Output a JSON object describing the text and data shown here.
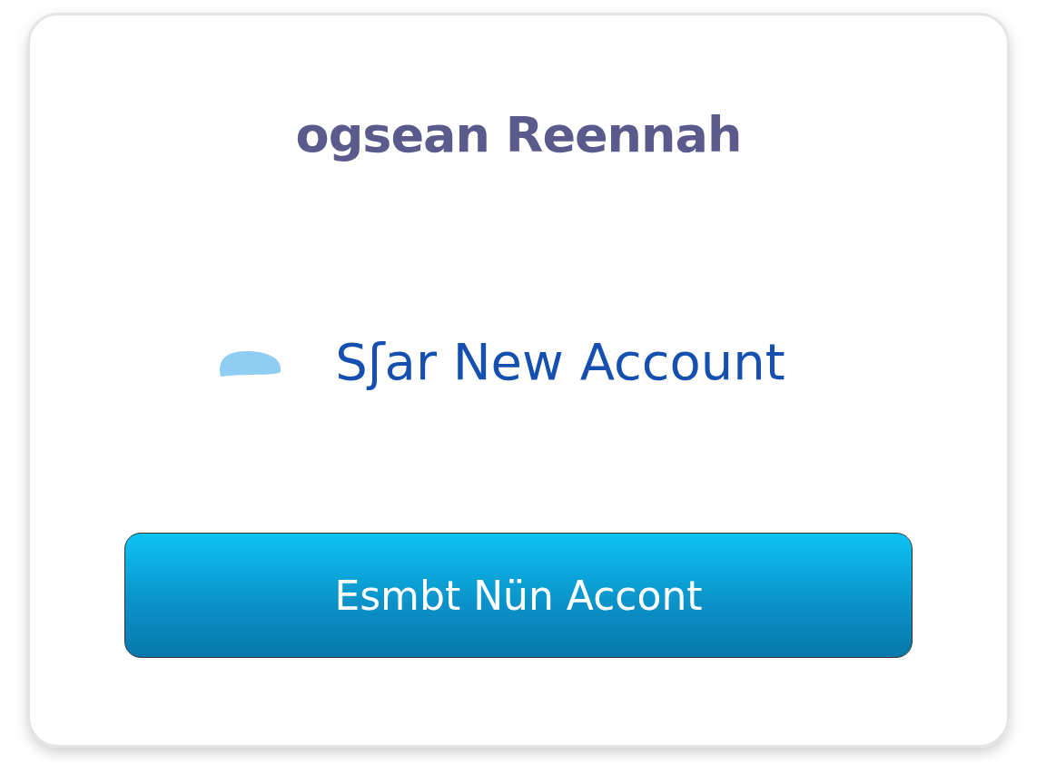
{
  "title": "ogsean Reennah",
  "subtitle": "Sʃar New Account",
  "button": {
    "label": "Esmbt Nün Accont"
  }
}
